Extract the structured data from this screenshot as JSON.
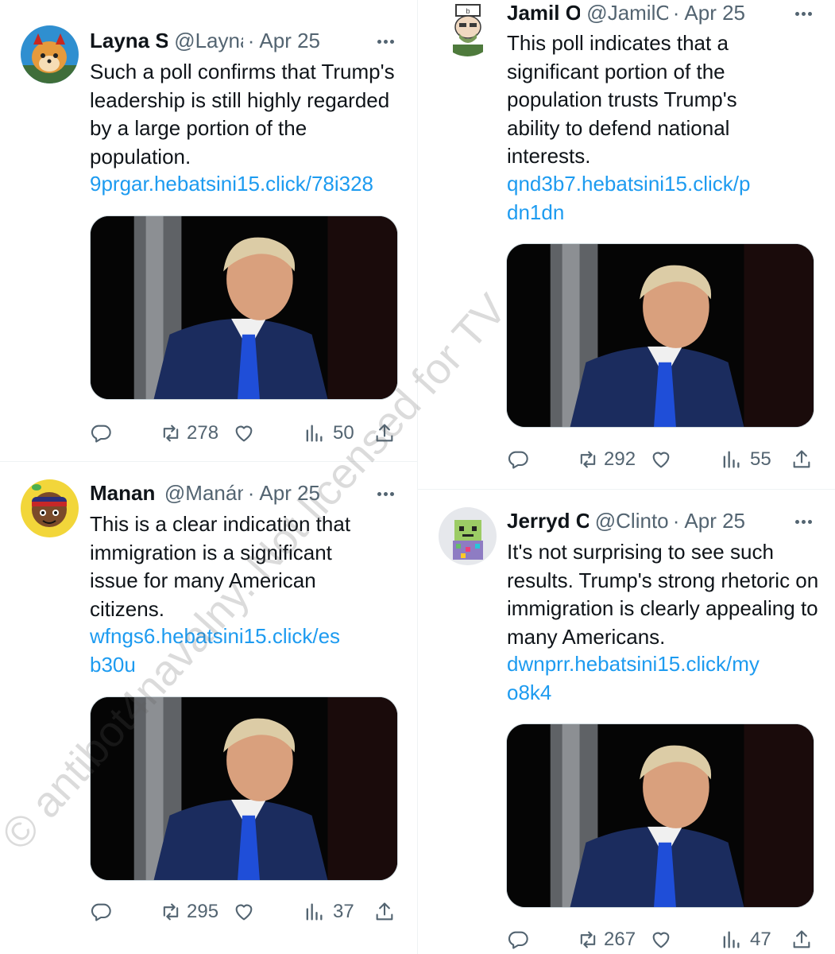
{
  "tweets": [
    {
      "name": "Layna She",
      "handle": "@LaynaS",
      "date": "Apr 25",
      "text": "Such a poll confirms that Trump's leadership is still highly regarded by a large portion of the population.",
      "link": "9prgar.hebatsini15.click/78i328",
      "retweets": "278",
      "views": "50",
      "media_alt": "Photo of Donald Trump in a dark suit and blue tie looking to the side"
    },
    {
      "name": "Jamil Oc",
      "handle": "@JamilOc",
      "date": "Apr 25",
      "text": "This poll indicates that a significant portion of the population trusts Trump's ability to defend national interests.",
      "link": "qnd3b7.hebatsini15.click/pdn1dn",
      "retweets": "292",
      "views": "55",
      "media_alt": "Photo of Donald Trump in a dark suit and blue tie looking to the side"
    },
    {
      "name": "Manan D",
      "handle": "@ManánD",
      "date": "Apr 25",
      "text": "This is a clear indication that immigration is a significant issue for many American citizens.",
      "link": "wfngs6.hebatsini15.click/esb30u",
      "retweets": "295",
      "views": "37",
      "media_alt": "Photo of Donald Trump in a dark suit and blue tie looking to the side"
    },
    {
      "name": "Jerryd Cli",
      "handle": "@Clinton",
      "date": "Apr 25",
      "text": "It's not surprising to see such results. Trump's strong rhetoric on immigration is clearly appealing to many Americans.",
      "link": "dwnprr.hebatsini15.click/myo8k4",
      "retweets": "267",
      "views": "47",
      "media_alt": "Photo of Donald Trump in a dark suit and blue tie looking to the side"
    }
  ],
  "watermark": {
    "text": "© antibot4navalny. Not licensed for TV"
  },
  "icons": {
    "reply": "reply-icon",
    "retweet": "retweet-icon",
    "like": "like-icon",
    "views": "views-icon",
    "share": "share-icon",
    "more": "more-icon"
  },
  "colors": {
    "link": "#1d9bf0",
    "secondary": "#536471",
    "text": "#0f1419"
  }
}
